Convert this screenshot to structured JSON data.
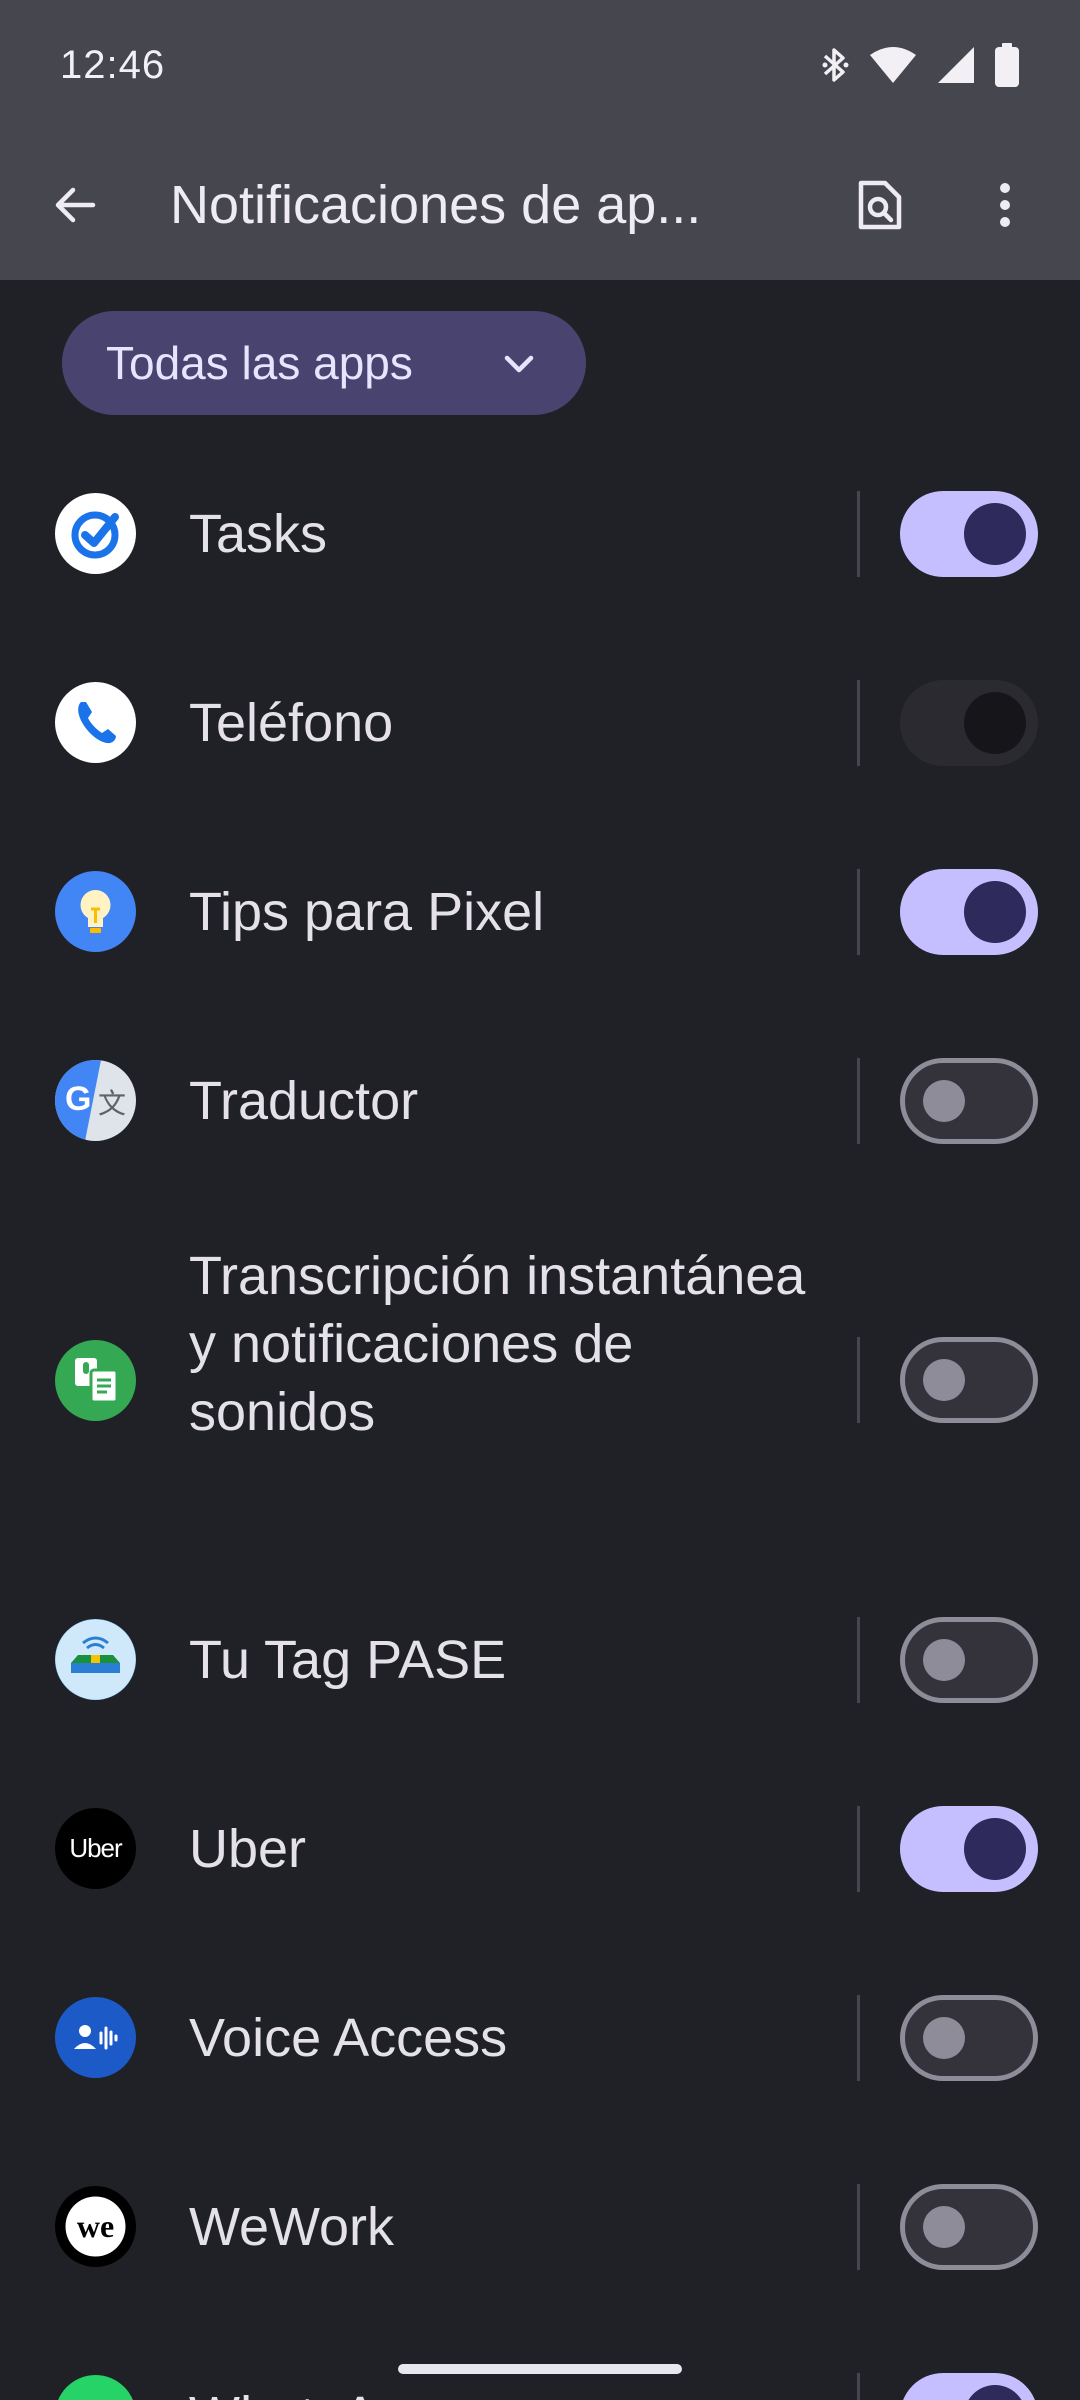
{
  "status_bar": {
    "time": "12:46",
    "icons": [
      "bluetooth-icon",
      "wifi-icon",
      "cell-signal-icon",
      "battery-icon"
    ]
  },
  "app_bar": {
    "title": "Notificaciones de ap...",
    "back_icon": "arrow-back-icon",
    "search_icon": "search-in-page-icon",
    "more_icon": "more-vert-icon"
  },
  "filter": {
    "label": "Todas las apps",
    "icon": "chevron-down-icon"
  },
  "apps": [
    {
      "name": "Tasks",
      "icon": "tasks-app-icon",
      "state": "on"
    },
    {
      "name": "Teléfono",
      "icon": "phone-app-icon",
      "state": "disabled"
    },
    {
      "name": "Tips para Pixel",
      "icon": "tips-app-icon",
      "state": "on"
    },
    {
      "name": "Traductor",
      "icon": "translate-app-icon",
      "state": "off"
    },
    {
      "name": "Transcripción instantánea y notificaciones de sonidos",
      "icon": "live-transcribe-app-icon",
      "state": "off"
    },
    {
      "name": "Tu Tag PASE",
      "icon": "tutag-pase-app-icon",
      "state": "off"
    },
    {
      "name": "Uber",
      "icon": "uber-app-icon",
      "state": "on"
    },
    {
      "name": "Voice Access",
      "icon": "voice-access-app-icon",
      "state": "off"
    },
    {
      "name": "WeWork",
      "icon": "wework-app-icon",
      "state": "off"
    },
    {
      "name": "WhatsApp",
      "icon": "whatsapp-app-icon",
      "state": "on"
    }
  ],
  "icon_text": {
    "uber": "Uber",
    "wework": "we",
    "translate_g": "G",
    "translate_x": "文"
  },
  "colors": {
    "background": "#202027",
    "app_bar": "#46464f",
    "chip": "#48446f",
    "toggle_on_track": "#c6bfff",
    "toggle_on_thumb": "#2e2a5b",
    "toggle_off_outline": "#8e8c98"
  }
}
